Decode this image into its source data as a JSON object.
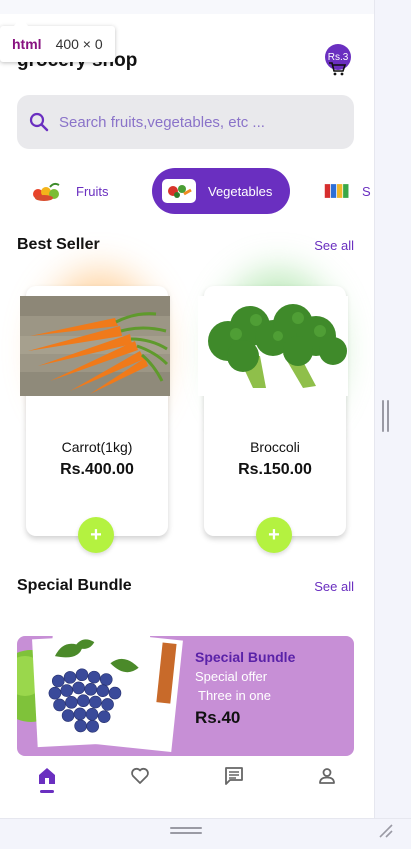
{
  "devtools": {
    "tag": "html",
    "dimensions": "400 × 0"
  },
  "header": {
    "title": "grocery shop",
    "cart_badge": "Rs.3"
  },
  "search": {
    "placeholder": "Search fruits,vegetables, etc ..."
  },
  "categories": [
    {
      "label": "Fruits",
      "active": false
    },
    {
      "label": "Vegetables",
      "active": true
    },
    {
      "label": "S",
      "active": false
    }
  ],
  "best_seller": {
    "heading": "Best Seller",
    "see_all": "See all",
    "products": [
      {
        "name": "Carrot(1kg)",
        "price": "Rs.400.00",
        "add": "+",
        "glow": "#ffb35c"
      },
      {
        "name": "Broccoli",
        "price": "Rs.150.00",
        "add": "+",
        "glow": "#7fd67a"
      }
    ]
  },
  "special_bundle": {
    "heading": "Special Bundle",
    "see_all": "See all",
    "card": {
      "title": "Special Bundle",
      "line1": "Special offer",
      "line2": "Three in one",
      "price": "Rs.40"
    }
  },
  "nav": {
    "items": [
      "home-icon",
      "heart-icon",
      "chat-icon",
      "person-icon"
    ],
    "active": "home-icon"
  },
  "colors": {
    "accent": "#6a2fc0",
    "add_button": "#b4f240",
    "bundle_bg": "#c78fd6"
  }
}
